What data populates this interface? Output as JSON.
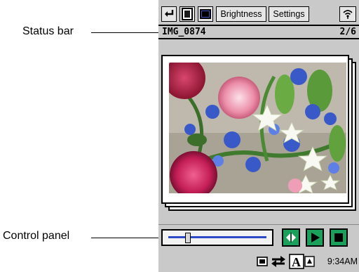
{
  "callouts": {
    "status_bar_label": "Status bar",
    "control_panel_label": "Control panel"
  },
  "toolbar": {
    "back_icon": "return-arrow-icon",
    "view_icon": "single-page-icon",
    "fullscreen_icon": "fullscreen-icon",
    "brightness_label": "Brightness",
    "settings_label": "Settings",
    "signal_icon": "wireless-icon"
  },
  "status_bar": {
    "filename": "IMG_0874",
    "position": "2/6"
  },
  "photo": {
    "description_icon": "flower-bouquet-photo"
  },
  "control_panel": {
    "slider_position": 0.2,
    "buttons": [
      "prev-next-icon",
      "play-icon",
      "stop-icon"
    ],
    "accent_color": "#1aa05a"
  },
  "taskbar": {
    "icons": [
      "keyboard-icon",
      "sync-icon",
      "text-size-icon"
    ],
    "time": "9:34AM"
  }
}
